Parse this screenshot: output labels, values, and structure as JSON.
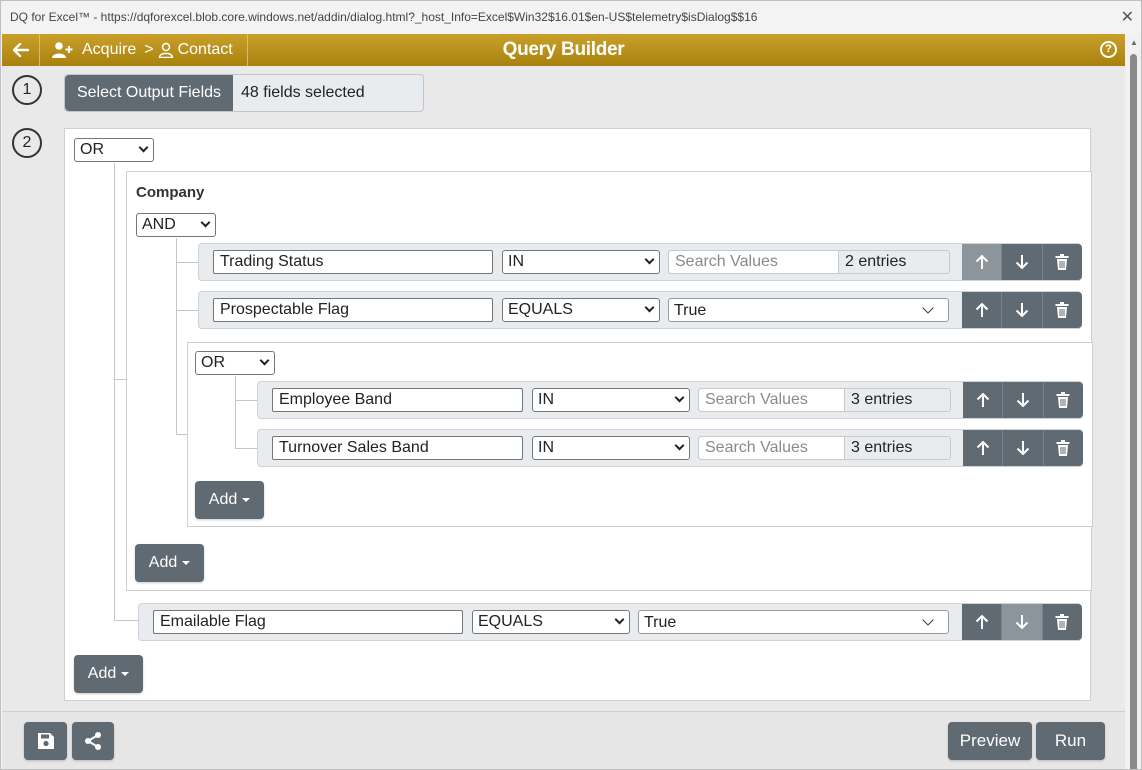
{
  "window": {
    "title": "DQ for Excel™ - https://dqforexcel.blob.core.windows.net/addin/dialog.html?_host_Info=Excel$Win32$16.01$en-US$telemetry$isDialog$$16"
  },
  "header": {
    "crumb_1": "Acquire",
    "separator": ">",
    "crumb_2": "Contact",
    "title": "Query Builder",
    "help_glyph": "?"
  },
  "steps": {
    "step1": "1",
    "step2": "2"
  },
  "output_fields": {
    "label": "Select Output Fields",
    "value": "48 fields selected"
  },
  "root": {
    "combinator": "OR",
    "add_label": "Add",
    "company_group": {
      "label": "Company",
      "combinator": "AND",
      "add_label": "Add",
      "rules": [
        {
          "field": "Trading Status",
          "operator": "IN",
          "placeholder": "Search Values",
          "count": "2 entries"
        },
        {
          "field": "Prospectable Flag",
          "operator": "EQUALS",
          "value": "True"
        }
      ],
      "sub_group": {
        "combinator": "OR",
        "add_label": "Add",
        "rules": [
          {
            "field": "Employee Band",
            "operator": "IN",
            "placeholder": "Search Values",
            "count": "3 entries"
          },
          {
            "field": "Turnover Sales Band",
            "operator": "IN",
            "placeholder": "Search Values",
            "count": "3 entries"
          }
        ]
      }
    },
    "rule": {
      "field": "Emailable Flag",
      "operator": "EQUALS",
      "value": "True"
    }
  },
  "footer": {
    "preview_label": "Preview",
    "run_label": "Run"
  },
  "icons": {
    "back": "arrow-left-icon",
    "add_user": "user-plus-icon",
    "user": "user-icon",
    "help": "help-circle-icon",
    "move_up": "arrow-up-icon",
    "move_down": "arrow-down-icon",
    "delete": "trash-icon",
    "save": "floppy-disk-icon",
    "share": "share-icon"
  },
  "colors": {
    "header_gold": "#b28a14",
    "button_slate": "#5f6a73"
  }
}
